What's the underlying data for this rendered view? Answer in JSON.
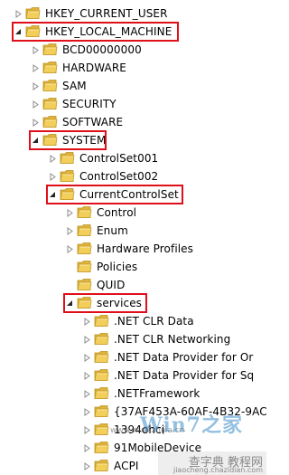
{
  "tree": [
    {
      "label": "HKEY_CURRENT_USER",
      "depth": 0,
      "expander": "collapsed",
      "highlighted": false
    },
    {
      "label": "HKEY_LOCAL_MACHINE",
      "depth": 0,
      "expander": "expanded",
      "highlighted": true
    },
    {
      "label": "BCD00000000",
      "depth": 1,
      "expander": "collapsed",
      "highlighted": false
    },
    {
      "label": "HARDWARE",
      "depth": 1,
      "expander": "collapsed",
      "highlighted": false
    },
    {
      "label": "SAM",
      "depth": 1,
      "expander": "collapsed",
      "highlighted": false
    },
    {
      "label": "SECURITY",
      "depth": 1,
      "expander": "collapsed",
      "highlighted": false
    },
    {
      "label": "SOFTWARE",
      "depth": 1,
      "expander": "collapsed",
      "highlighted": false
    },
    {
      "label": "SYSTEM",
      "depth": 1,
      "expander": "expanded",
      "highlighted": true
    },
    {
      "label": "ControlSet001",
      "depth": 2,
      "expander": "collapsed",
      "highlighted": false
    },
    {
      "label": "ControlSet002",
      "depth": 2,
      "expander": "collapsed",
      "highlighted": false
    },
    {
      "label": "CurrentControlSet",
      "depth": 2,
      "expander": "expanded",
      "highlighted": true
    },
    {
      "label": "Control",
      "depth": 3,
      "expander": "collapsed",
      "highlighted": false
    },
    {
      "label": "Enum",
      "depth": 3,
      "expander": "collapsed",
      "highlighted": false
    },
    {
      "label": "Hardware Profiles",
      "depth": 3,
      "expander": "collapsed",
      "highlighted": false
    },
    {
      "label": "Policies",
      "depth": 3,
      "expander": "none",
      "highlighted": false
    },
    {
      "label": "QUID",
      "depth": 3,
      "expander": "none",
      "highlighted": false
    },
    {
      "label": "services",
      "depth": 3,
      "expander": "expanded",
      "highlighted": true
    },
    {
      "label": ".NET CLR Data",
      "depth": 4,
      "expander": "collapsed",
      "highlighted": false
    },
    {
      "label": ".NET CLR Networking",
      "depth": 4,
      "expander": "collapsed",
      "highlighted": false
    },
    {
      "label": ".NET Data Provider for Or",
      "depth": 4,
      "expander": "collapsed",
      "highlighted": false
    },
    {
      "label": ".NET Data Provider for Sq",
      "depth": 4,
      "expander": "collapsed",
      "highlighted": false
    },
    {
      "label": ".NETFramework",
      "depth": 4,
      "expander": "collapsed",
      "highlighted": false
    },
    {
      "label": "{37AF453A-60AF-4B32-9AC",
      "depth": 4,
      "expander": "collapsed",
      "highlighted": false
    },
    {
      "label": "1394ohci",
      "depth": 4,
      "expander": "collapsed",
      "highlighted": false
    },
    {
      "label": "91MobileDevice",
      "depth": 4,
      "expander": "collapsed",
      "highlighted": false
    },
    {
      "label": "ACPI",
      "depth": 4,
      "expander": "collapsed",
      "highlighted": false
    }
  ],
  "watermark": {
    "logo": "Win7之家",
    "url": "www.win7zhijia.cn",
    "corner_text": "查字典 教程网",
    "corner_url": "jiaocheng.chazidian.com"
  },
  "colors": {
    "highlight_box": "#e0101a",
    "folder_body": "#f2cf5b",
    "folder_tab": "#e0b43a"
  }
}
